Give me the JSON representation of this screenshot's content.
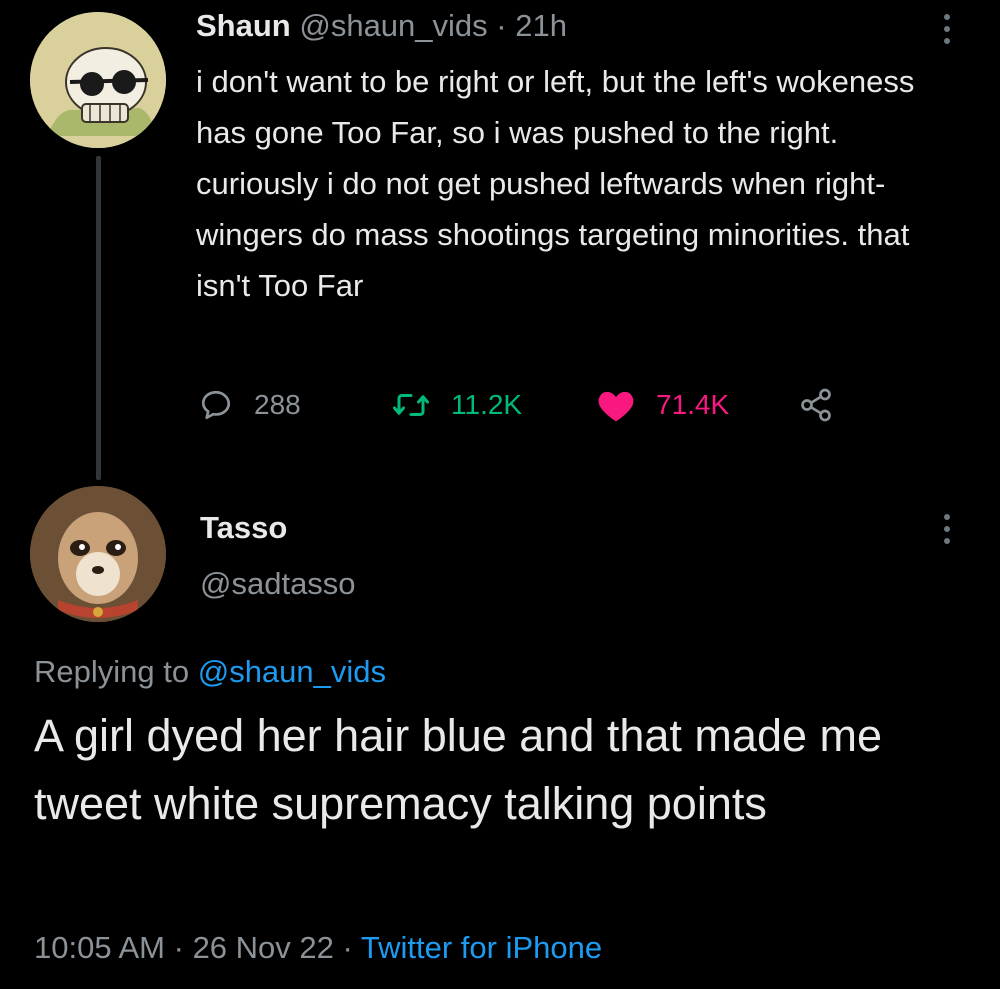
{
  "parent_tweet": {
    "author_name": "Shaun",
    "author_handle": "@shaun_vids",
    "separator": "·",
    "time": "21h",
    "text": "i don't want to be right or left, but the left's wokeness has gone Too Far, so i was pushed to the right. curiously i do not get pushed leftwards when right-wingers do mass shootings targeting minorities. that isn't Too Far",
    "actions": {
      "reply_count": "288",
      "retweet_count": "11.2K",
      "like_count": "71.4K"
    },
    "icons": {
      "reply": "reply-icon",
      "retweet": "retweet-icon",
      "like": "heart-icon",
      "share": "share-icon",
      "more": "more-icon"
    }
  },
  "reply_tweet": {
    "author_name": "Tasso",
    "author_handle": "@sadtasso",
    "replying_to_label": "Replying to",
    "replying_to_handle": "@shaun_vids",
    "text": "A girl dyed her hair blue and that made me tweet white supremacy talking points",
    "time": "10:05 AM",
    "separator": "·",
    "date": "26 Nov 22",
    "source": "Twitter for iPhone"
  },
  "colors": {
    "background": "#000000",
    "text_primary": "#e7e9ea",
    "text_secondary": "#8b9298",
    "link": "#1d9bf0",
    "retweet": "#00ba7c",
    "like": "#f91880"
  }
}
